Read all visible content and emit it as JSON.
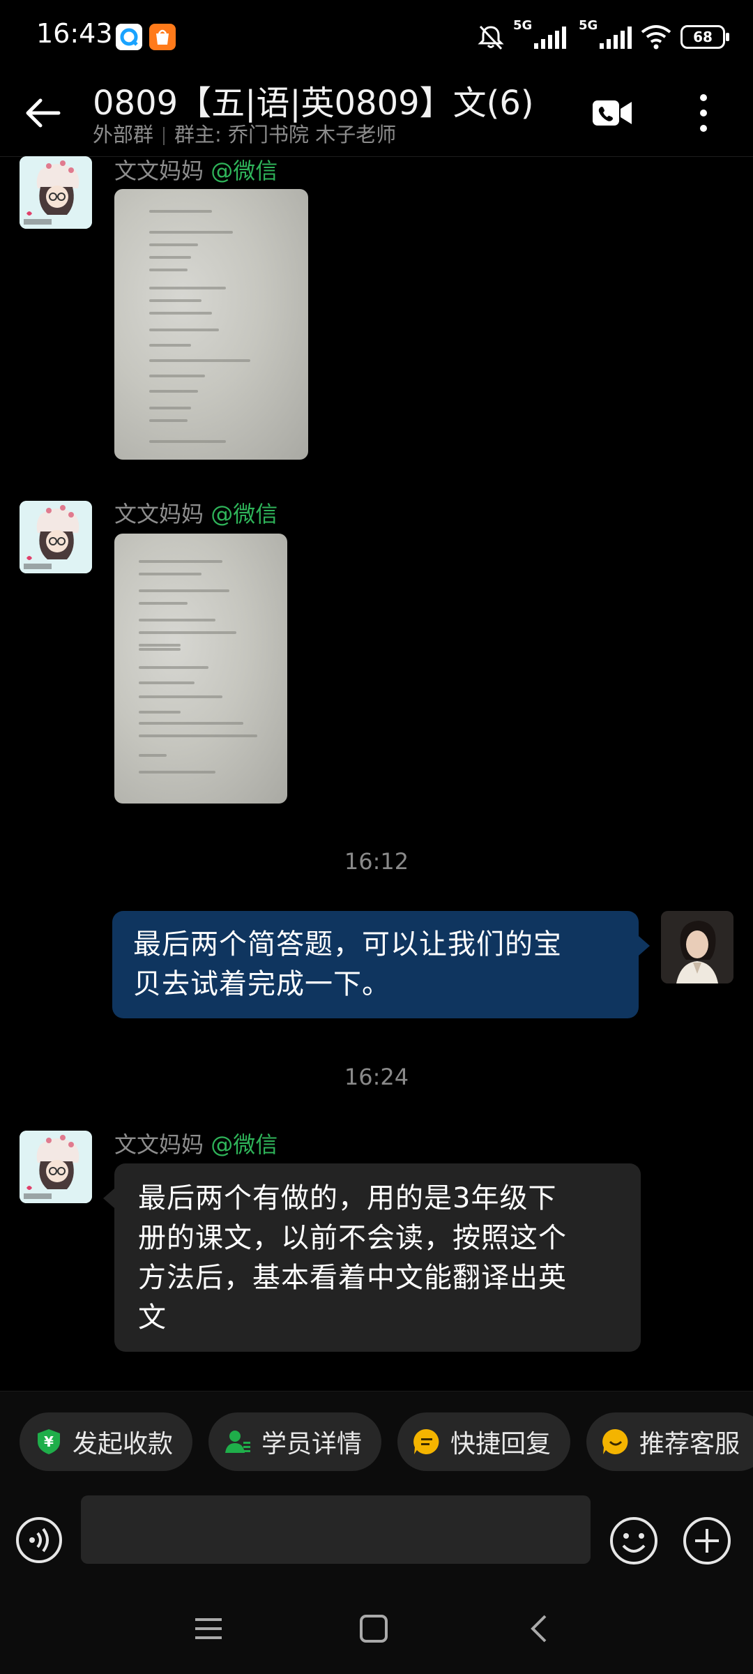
{
  "status_bar": {
    "time": "16:43",
    "signal_1_label": "5G",
    "signal_2_label": "5G",
    "battery": "68",
    "icons": [
      "qq-browser-icon",
      "taobao-icon",
      "mute-bell-icon",
      "signal-icon",
      "wifi-icon",
      "battery-icon"
    ]
  },
  "header": {
    "title": "0809【五|语|英0809】文(6)",
    "group_type": "外部群",
    "owner": "群主: 乔门书院 木子老师"
  },
  "messages": [
    {
      "type": "image",
      "sender": "文文妈妈",
      "source": "@微信"
    },
    {
      "type": "image",
      "sender": "文文妈妈",
      "source": "@微信"
    },
    {
      "type": "timestamp",
      "text": "16:12"
    },
    {
      "type": "text_out",
      "text_line1": "最后两个简答题，可以让我们的宝",
      "text_line2": "贝去试着完成一下。"
    },
    {
      "type": "timestamp",
      "text": "16:24"
    },
    {
      "type": "text_in",
      "sender": "文文妈妈",
      "source": "@微信",
      "line1": "最后两个有做的，用的是3年级下",
      "line2": "册的课文，以前不会读，按照这个",
      "line3": "方法后，基本看着中文能翻译出英",
      "line4": "文"
    }
  ],
  "quick_actions": [
    {
      "label": "发起收款",
      "icon": "payment-shield-icon",
      "color": "#1fae4a"
    },
    {
      "label": "学员详情",
      "icon": "student-profile-icon",
      "color": "#1fae4a"
    },
    {
      "label": "快捷回复",
      "icon": "quick-reply-icon",
      "color": "#f4b400"
    },
    {
      "label": "推荐客服",
      "icon": "recommend-service-icon",
      "color": "#f4b400"
    }
  ],
  "input": {
    "placeholder": ""
  },
  "colors": {
    "out_bubble": "#0f355f",
    "in_bubble": "#232323",
    "wechat_green": "#2fb55a"
  }
}
